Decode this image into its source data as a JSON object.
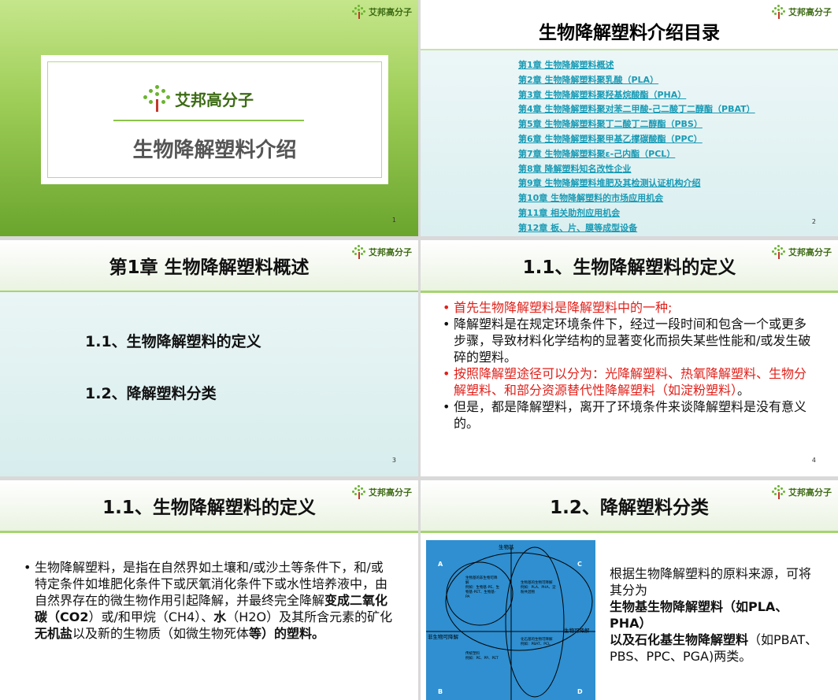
{
  "brand": {
    "logo_text": "艾邦高分子"
  },
  "slide1": {
    "title": "生物降解塑料介绍",
    "page": "1"
  },
  "slide2": {
    "title": "生物降解塑料介绍目录",
    "page": "2",
    "toc": [
      "第1章 生物降解塑料概述",
      "第2章 生物降解塑料聚乳酸（PLA）",
      "第3章 生物降解塑料聚羟基烷酸酯（PHA）",
      "第4章 生物降解塑料聚对苯二甲酸-己二酸丁二醇酯（PBAT）",
      "第5章 生物降解塑料聚丁二酸丁二醇酯（PBS）",
      "第6章 生物降解塑料聚甲基乙撑碳酸酯（PPC）",
      "第7章 生物降解塑料聚ε-己内酯（PCL）",
      "第8章 降解塑料知名改性企业",
      "第9章 生物降解塑料堆肥及其检测认证机构介绍",
      "第10章 生物降解塑料的市场应用机会",
      "第11章 相关助剂应用机会",
      "第12章 板、片、膜等成型设备"
    ]
  },
  "slide3": {
    "title": "第1章 生物降解塑料概述",
    "items": [
      "1.1、生物降解塑料的定义",
      "1.2、降解塑料分类"
    ],
    "page": "3"
  },
  "slide4": {
    "title": "1.1、生物降解塑料的定义",
    "page": "4",
    "bullets": [
      "首先生物降解塑料是降解塑料中的一种;",
      "降解塑料是在规定环境条件下，经过一段时间和包含一个或更多步骤，导致材料化学结构的显著变化而损失某些性能和/或发生破碎的塑料。",
      "按照降解塑途径可以分为：光降解塑料、热氧降解塑料、生物分解塑料、和部分资源替代性降解塑料（如淀粉塑料）",
      "。",
      "但是，都是降解塑料，离开了环境条件来谈降解塑料是没有意义的。"
    ]
  },
  "slide5": {
    "title": "1.1、生物降解塑料的定义",
    "text_1": "生物降解塑料，是指在自然界如土壤和/或沙土等条件下，和/或特定条件如堆肥化条件下或厌氧消化条件下或水性培养液中，由自然界存在的微生物作用引起降解，并最终完全降解",
    "bold_1": "变成二氧化碳（CO2",
    "text_2": "）或/和甲烷（CH4）、",
    "bold_2": "水",
    "text_3": "（H2O）及其所含元素的矿化",
    "bold_3": "无机盐",
    "text_4": "以及新的生物质（如微生物死体",
    "bold_4": "等）的塑料。"
  },
  "slide6": {
    "title": "1.2、降解塑料分类",
    "text_1": "根据生物降解塑料的原料来源，可将其分为",
    "bold_1": "生物基生物降解塑料（如PLA、PHA）",
    "bold_2": "以及石化基生物降解塑料",
    "text_2": "（如PBAT、PBS、PPC、PGA)两类。",
    "diagram": {
      "top": "生物基",
      "left": "非生物可降解",
      "right": "生物可降解",
      "corner_a": "A",
      "corner_b": "B",
      "corner_c": "C",
      "corner_d": "D",
      "q1_title": "生物基的非生物可降解",
      "q1_examples": "例如：生物基-PE、生物基-PET、生物基-PA",
      "q2_title": "生物基的生物可降解",
      "q2_examples": "例如：PLA、PHA、淀粉共混物",
      "q3_title": "传统塑料",
      "q3_examples": "例如：PE、PP、PET",
      "q4_title": "化石基的生物可降解",
      "q4_examples": "例如：PBAT、PCL"
    }
  }
}
